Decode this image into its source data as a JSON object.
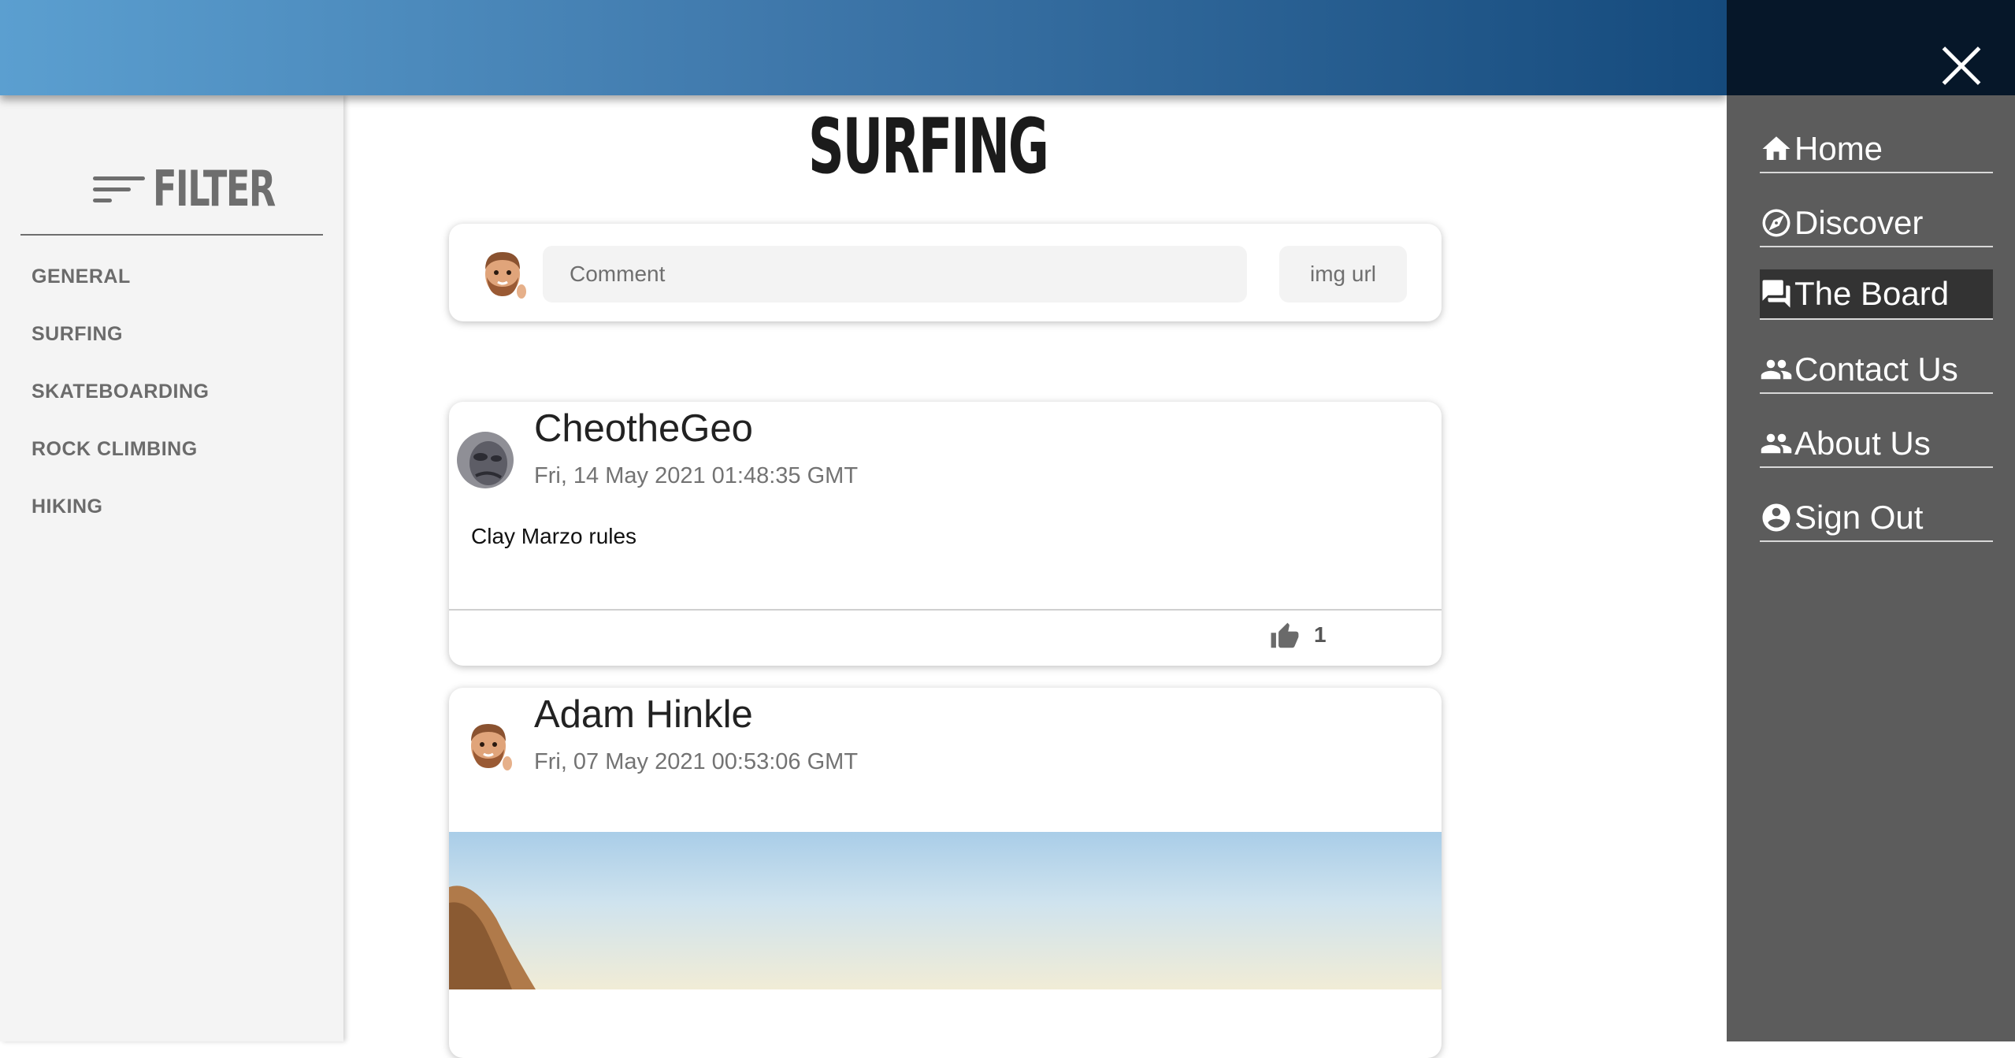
{
  "sidebar": {
    "title": "FILTER",
    "categories": [
      "GENERAL",
      "SURFING",
      "SKATEBOARDING",
      "ROCK CLIMBING",
      "HIKING"
    ]
  },
  "page": {
    "title": "SURFING"
  },
  "composer": {
    "comment_placeholder": "Comment",
    "img_url_placeholder": "img url"
  },
  "posts": [
    {
      "author": "CheotheGeo",
      "date": "Fri, 14 May 2021 01:48:35 GMT",
      "text": "Clay Marzo rules",
      "likes": "1"
    },
    {
      "author": "Adam Hinkle",
      "date": "Fri, 07 May 2021 00:53:06 GMT"
    }
  ],
  "nav": {
    "items": [
      {
        "label": "Home",
        "icon": "home-icon"
      },
      {
        "label": "Discover",
        "icon": "compass-icon"
      },
      {
        "label": "The Board",
        "icon": "chat-icon",
        "active": true
      },
      {
        "label": "Contact Us",
        "icon": "people-icon"
      },
      {
        "label": "About Us",
        "icon": "people-icon"
      },
      {
        "label": "Sign Out",
        "icon": "account-circle-icon"
      }
    ]
  },
  "colors": {
    "header_gradient_start": "#5b9fd0",
    "header_gradient_end": "#154a7c",
    "drawer_bg": "#5c5c5c",
    "drawer_top": "#061729",
    "active_nav": "#333333"
  }
}
